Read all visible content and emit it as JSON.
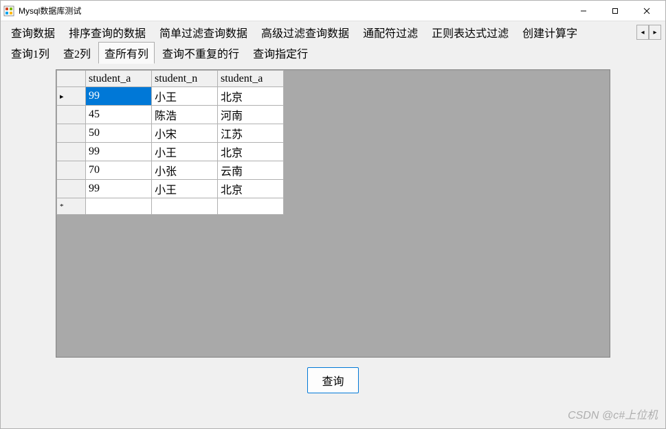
{
  "window": {
    "title": "Mysql数据库测试"
  },
  "primary_tabs": {
    "items": [
      {
        "label": "查询数据"
      },
      {
        "label": "排序查询的数据"
      },
      {
        "label": "简单过滤查询数据"
      },
      {
        "label": "高级过滤查询数据"
      },
      {
        "label": "通配符过滤"
      },
      {
        "label": "正则表达式过滤"
      },
      {
        "label": "创建计算字"
      }
    ],
    "scroll_left": "◂",
    "scroll_right": "▸"
  },
  "secondary_tabs": {
    "items": [
      {
        "label": "查询1列"
      },
      {
        "label": "查2列"
      },
      {
        "label": "查所有列",
        "active": true
      },
      {
        "label": "查询不重复的行"
      },
      {
        "label": "查询指定行"
      }
    ]
  },
  "grid": {
    "columns": [
      "student_a",
      "student_n",
      "student_a"
    ],
    "row_indicator_current": "▸",
    "row_indicator_new": "*",
    "rows": [
      {
        "c0": "99",
        "c1": "小王",
        "c2": "北京",
        "selected_col": 0
      },
      {
        "c0": "45",
        "c1": "陈浩",
        "c2": "河南"
      },
      {
        "c0": "50",
        "c1": "小宋",
        "c2": "江苏"
      },
      {
        "c0": "99",
        "c1": "小王",
        "c2": "北京"
      },
      {
        "c0": "70",
        "c1": "小张",
        "c2": "云南"
      },
      {
        "c0": "99",
        "c1": "小王",
        "c2": "北京"
      }
    ]
  },
  "buttons": {
    "query": "查询"
  },
  "watermark": "CSDN @c#上位机"
}
